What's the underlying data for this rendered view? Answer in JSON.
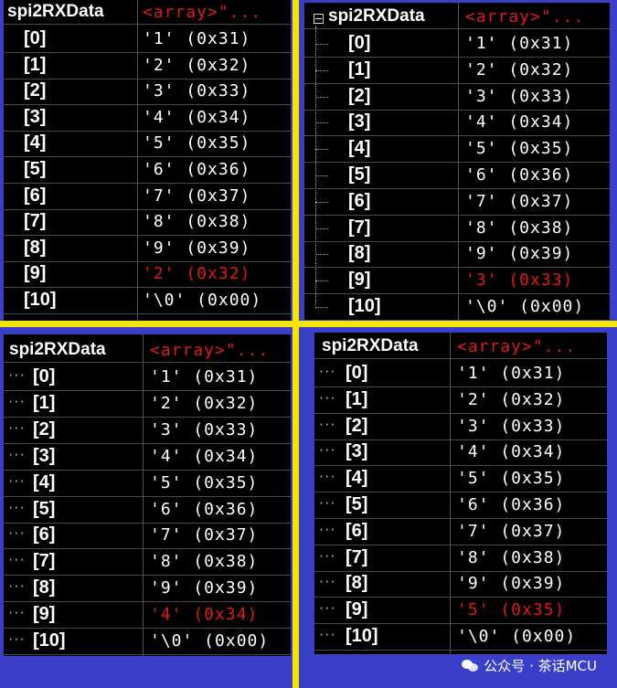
{
  "colors": {
    "background": "#3a3fc8",
    "divider": "#f4e400",
    "changed_value": "#e01a1a",
    "panel": "#000000"
  },
  "watch_panels": [
    {
      "variable_name": "spi2RXData",
      "type_label": "<array>\"...",
      "rows": [
        {
          "index": "[0]",
          "value": "'1' (0x31)"
        },
        {
          "index": "[1]",
          "value": "'2' (0x32)"
        },
        {
          "index": "[2]",
          "value": "'3' (0x33)"
        },
        {
          "index": "[3]",
          "value": "'4' (0x34)"
        },
        {
          "index": "[4]",
          "value": "'5' (0x35)"
        },
        {
          "index": "[5]",
          "value": "'6' (0x36)"
        },
        {
          "index": "[6]",
          "value": "'7' (0x37)"
        },
        {
          "index": "[7]",
          "value": "'8' (0x38)"
        },
        {
          "index": "[8]",
          "value": "'9' (0x39)"
        },
        {
          "index": "[9]",
          "value": "'2' (0x32)",
          "changed": true
        },
        {
          "index": "[10]",
          "value": "'\\0' (0x00)"
        }
      ]
    },
    {
      "variable_name": "spi2RXData",
      "type_label": "<array>\"...",
      "rows": [
        {
          "index": "[0]",
          "value": "'1' (0x31)"
        },
        {
          "index": "[1]",
          "value": "'2' (0x32)"
        },
        {
          "index": "[2]",
          "value": "'3' (0x33)"
        },
        {
          "index": "[3]",
          "value": "'4' (0x34)"
        },
        {
          "index": "[4]",
          "value": "'5' (0x35)"
        },
        {
          "index": "[5]",
          "value": "'6' (0x36)"
        },
        {
          "index": "[6]",
          "value": "'7' (0x37)"
        },
        {
          "index": "[7]",
          "value": "'8' (0x38)"
        },
        {
          "index": "[8]",
          "value": "'9' (0x39)"
        },
        {
          "index": "[9]",
          "value": "'3' (0x33)",
          "changed": true
        },
        {
          "index": "[10]",
          "value": "'\\0' (0x00)"
        }
      ]
    },
    {
      "variable_name": "spi2RXData",
      "type_label": "<array>\"...",
      "rows": [
        {
          "index": "[0]",
          "value": "'1' (0x31)"
        },
        {
          "index": "[1]",
          "value": "'2' (0x32)"
        },
        {
          "index": "[2]",
          "value": "'3' (0x33)"
        },
        {
          "index": "[3]",
          "value": "'4' (0x34)"
        },
        {
          "index": "[4]",
          "value": "'5' (0x35)"
        },
        {
          "index": "[5]",
          "value": "'6' (0x36)"
        },
        {
          "index": "[6]",
          "value": "'7' (0x37)"
        },
        {
          "index": "[7]",
          "value": "'8' (0x38)"
        },
        {
          "index": "[8]",
          "value": "'9' (0x39)"
        },
        {
          "index": "[9]",
          "value": "'4' (0x34)",
          "changed": true
        },
        {
          "index": "[10]",
          "value": "'\\0' (0x00)"
        }
      ]
    },
    {
      "variable_name": "spi2RXData",
      "type_label": "<array>\"...",
      "rows": [
        {
          "index": "[0]",
          "value": "'1' (0x31)"
        },
        {
          "index": "[1]",
          "value": "'2' (0x32)"
        },
        {
          "index": "[2]",
          "value": "'3' (0x33)"
        },
        {
          "index": "[3]",
          "value": "'4' (0x34)"
        },
        {
          "index": "[4]",
          "value": "'5' (0x35)"
        },
        {
          "index": "[5]",
          "value": "'6' (0x36)"
        },
        {
          "index": "[6]",
          "value": "'7' (0x37)"
        },
        {
          "index": "[7]",
          "value": "'8' (0x38)"
        },
        {
          "index": "[8]",
          "value": "'9' (0x39)"
        },
        {
          "index": "[9]",
          "value": "'5' (0x35)",
          "changed": true
        },
        {
          "index": "[10]",
          "value": "'\\0' (0x00)"
        }
      ]
    }
  ],
  "watermark": {
    "icon": "wechat-icon",
    "text": "公众号 · 茶话MCU"
  }
}
